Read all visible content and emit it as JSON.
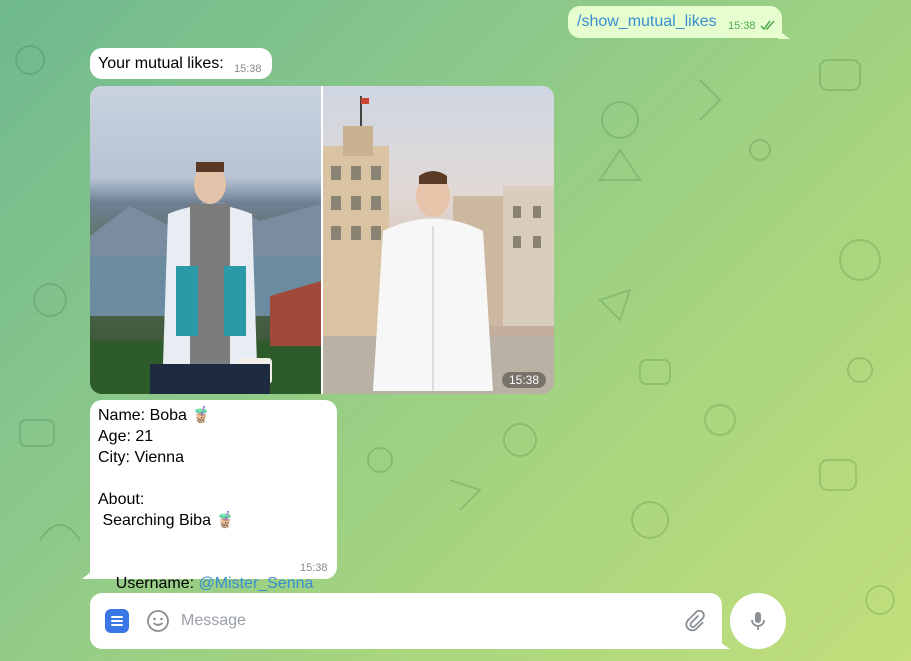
{
  "outgoing": {
    "command": "/show_mutual_likes",
    "time": "15:38"
  },
  "intro": {
    "text": "Your mutual likes:",
    "time": "15:38"
  },
  "album": {
    "time": "15:38"
  },
  "profile": {
    "name_line": "Name: Boba 🧋",
    "age_line": "Age: 21",
    "city_line": "City: Vienna",
    "about_label": "About:",
    "about_text": " Searching Biba 🧋",
    "username_label": "Username: ",
    "username": "@Mister_Senna",
    "time": "15:38"
  },
  "composer": {
    "placeholder": "Message"
  },
  "colors": {
    "accent": "#3a76e6",
    "link": "#3a8fd0",
    "outgoing_bubble": "#e6fdd0",
    "read_check": "#4ea84c"
  },
  "icons": [
    "menu-icon",
    "emoji-icon",
    "attach-icon",
    "microphone-icon",
    "read-checks-icon"
  ]
}
